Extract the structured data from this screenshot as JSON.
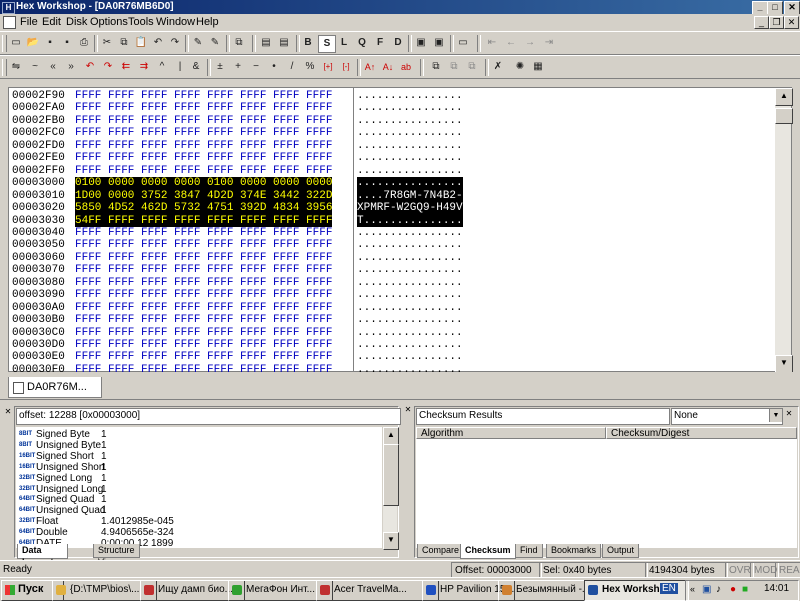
{
  "window": {
    "title": "Hex Workshop - [DA0R76MB6D0]"
  },
  "menu": [
    "File",
    "Edit",
    "Disk",
    "Options",
    "Tools",
    "Window",
    "Help"
  ],
  "toolbar1": {
    "buttons": [
      "new-icon",
      "open-icon",
      "save-icon",
      "saveall-icon",
      "print-icon",
      "cut-icon",
      "copy-icon",
      "paste-icon",
      "undo-icon",
      "redo-icon",
      "find-icon",
      "findnext-icon",
      "goto-icon",
      "bytes-icon",
      "words-icon"
    ],
    "format_letters": [
      "B",
      "S",
      "L",
      "Q",
      "F",
      "D"
    ]
  },
  "toolbar2": {
    "ops": [
      "⇋",
      "~",
      "«",
      "»",
      "↶",
      "↷",
      "⇇",
      "⇉",
      "^",
      "|",
      "&",
      "±",
      "+",
      "−",
      "•",
      "/",
      "%",
      "[+]",
      "[-]",
      "A↑",
      "A↓",
      "ab"
    ],
    "nav": [
      "⇤",
      "←",
      "→",
      "⇥"
    ]
  },
  "hex": {
    "rows": [
      {
        "offset": "00002F90",
        "hex": "FFFF FFFF FFFF FFFF FFFF FFFF FFFF FFFF",
        "ascii": "................",
        "sel": false
      },
      {
        "offset": "00002FA0",
        "hex": "FFFF FFFF FFFF FFFF FFFF FFFF FFFF FFFF",
        "ascii": "................",
        "sel": false
      },
      {
        "offset": "00002FB0",
        "hex": "FFFF FFFF FFFF FFFF FFFF FFFF FFFF FFFF",
        "ascii": "................",
        "sel": false
      },
      {
        "offset": "00002FC0",
        "hex": "FFFF FFFF FFFF FFFF FFFF FFFF FFFF FFFF",
        "ascii": "................",
        "sel": false
      },
      {
        "offset": "00002FD0",
        "hex": "FFFF FFFF FFFF FFFF FFFF FFFF FFFF FFFF",
        "ascii": "................",
        "sel": false
      },
      {
        "offset": "00002FE0",
        "hex": "FFFF FFFF FFFF FFFF FFFF FFFF FFFF FFFF",
        "ascii": "................",
        "sel": false
      },
      {
        "offset": "00002FF0",
        "hex": "FFFF FFFF FFFF FFFF FFFF FFFF FFFF FFFF",
        "ascii": "................",
        "sel": false
      },
      {
        "offset": "00003000",
        "hex": "0100 0000 0000 0000 0100 0000 0000 0000",
        "ascii": "................",
        "sel": true
      },
      {
        "offset": "00003010",
        "hex": "1D00 0000 3752 3847 4D2D 374E 3442 322D",
        "ascii": "....7R8GM-7N4B2-",
        "sel": true
      },
      {
        "offset": "00003020",
        "hex": "5850 4D52 462D 5732 4751 392D 4834 3956",
        "ascii": "XPMRF-W2GQ9-H49V",
        "sel": true
      },
      {
        "offset": "00003030",
        "hex": "54FF FFFF FFFF FFFF FFFF FFFF FFFF FFFF",
        "ascii": "T...............",
        "sel": true
      },
      {
        "offset": "00003040",
        "hex": "FFFF FFFF FFFF FFFF FFFF FFFF FFFF FFFF",
        "ascii": "................",
        "sel": false
      },
      {
        "offset": "00003050",
        "hex": "FFFF FFFF FFFF FFFF FFFF FFFF FFFF FFFF",
        "ascii": "................",
        "sel": false
      },
      {
        "offset": "00003060",
        "hex": "FFFF FFFF FFFF FFFF FFFF FFFF FFFF FFFF",
        "ascii": "................",
        "sel": false
      },
      {
        "offset": "00003070",
        "hex": "FFFF FFFF FFFF FFFF FFFF FFFF FFFF FFFF",
        "ascii": "................",
        "sel": false
      },
      {
        "offset": "00003080",
        "hex": "FFFF FFFF FFFF FFFF FFFF FFFF FFFF FFFF",
        "ascii": "................",
        "sel": false
      },
      {
        "offset": "00003090",
        "hex": "FFFF FFFF FFFF FFFF FFFF FFFF FFFF FFFF",
        "ascii": "................",
        "sel": false
      },
      {
        "offset": "000030A0",
        "hex": "FFFF FFFF FFFF FFFF FFFF FFFF FFFF FFFF",
        "ascii": "................",
        "sel": false
      },
      {
        "offset": "000030B0",
        "hex": "FFFF FFFF FFFF FFFF FFFF FFFF FFFF FFFF",
        "ascii": "................",
        "sel": false
      },
      {
        "offset": "000030C0",
        "hex": "FFFF FFFF FFFF FFFF FFFF FFFF FFFF FFFF",
        "ascii": "................",
        "sel": false
      },
      {
        "offset": "000030D0",
        "hex": "FFFF FFFF FFFF FFFF FFFF FFFF FFFF FFFF",
        "ascii": "................",
        "sel": false
      },
      {
        "offset": "000030E0",
        "hex": "FFFF FFFF FFFF FFFF FFFF FFFF FFFF FFFF",
        "ascii": "................",
        "sel": false
      },
      {
        "offset": "000030F0",
        "hex": "FFFF FFFF FFFF FFFF FFFF FFFF FFFF FFFF",
        "ascii": "................",
        "sel": false
      }
    ]
  },
  "doc_tab": {
    "label": "DA0R76M..."
  },
  "data_inspector": {
    "offset_label": "offset: 12288 [0x00003000]",
    "rows": [
      {
        "bits": "8BIT",
        "name": "Signed Byte",
        "value": "1"
      },
      {
        "bits": "8BIT",
        "name": "Unsigned Byte",
        "value": "1"
      },
      {
        "bits": "16BIT",
        "name": "Signed Short",
        "value": "1"
      },
      {
        "bits": "16BIT",
        "name": "Unsigned Short",
        "value": "1"
      },
      {
        "bits": "32BIT",
        "name": "Signed Long",
        "value": "1"
      },
      {
        "bits": "32BIT",
        "name": "Unsigned Long",
        "value": "1"
      },
      {
        "bits": "64BIT",
        "name": "Signed Quad",
        "value": "1"
      },
      {
        "bits": "64BIT",
        "name": "Unsigned Quad",
        "value": "1"
      },
      {
        "bits": "32BIT",
        "name": "Float",
        "value": "1.4012985e-045"
      },
      {
        "bits": "64BIT",
        "name": "Double",
        "value": "4.9406565e-324"
      },
      {
        "bits": "64BIT",
        "name": "DATE",
        "value": "0:00:00 12 1899"
      }
    ],
    "tabs": [
      "Data Inspector",
      "Structure Viewer"
    ]
  },
  "checksum": {
    "title": "Checksum Results",
    "select_value": "None",
    "columns": [
      "Algorithm",
      "Checksum/Digest"
    ],
    "tabs": [
      "Compare",
      "Checksum",
      "Find",
      "Bookmarks",
      "Output"
    ],
    "active_tab": "Checksum"
  },
  "status": {
    "ready": "Ready",
    "offset": "Offset: 00003000",
    "sel": "Sel: 0x40 bytes",
    "size": "4194304 bytes",
    "ovr": "OVR",
    "mod": "MOD",
    "read": "READ"
  },
  "taskbar": {
    "start": "Пуск",
    "tasks": [
      {
        "label": "{D:\\TMP\\bios\\...",
        "color": "#e0b040"
      },
      {
        "label": "Ищу дамп био...",
        "color": "#c03030"
      },
      {
        "label": "МегаФон Инт...",
        "color": "#30a030"
      },
      {
        "label": "Acer TravelMa...",
        "color": "#c03030"
      },
      {
        "label": "HP Pavilion 15-...",
        "color": "#2050c0"
      },
      {
        "label": "Безымянный -...",
        "color": "#d08030"
      },
      {
        "label": "Hex Worksh...",
        "color": "#2050a0"
      }
    ],
    "lang": "EN",
    "clock": "14:01"
  }
}
